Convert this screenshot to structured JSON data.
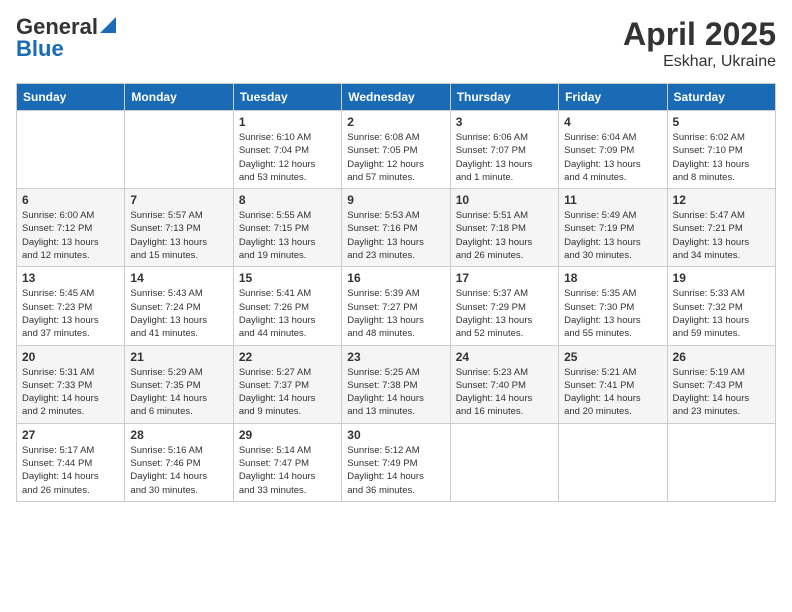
{
  "logo": {
    "general": "General",
    "blue": "Blue"
  },
  "title": {
    "month": "April 2025",
    "location": "Eskhar, Ukraine"
  },
  "weekdays": [
    "Sunday",
    "Monday",
    "Tuesday",
    "Wednesday",
    "Thursday",
    "Friday",
    "Saturday"
  ],
  "rows": [
    [
      {
        "day": "",
        "info": ""
      },
      {
        "day": "",
        "info": ""
      },
      {
        "day": "1",
        "info": "Sunrise: 6:10 AM\nSunset: 7:04 PM\nDaylight: 12 hours\nand 53 minutes."
      },
      {
        "day": "2",
        "info": "Sunrise: 6:08 AM\nSunset: 7:05 PM\nDaylight: 12 hours\nand 57 minutes."
      },
      {
        "day": "3",
        "info": "Sunrise: 6:06 AM\nSunset: 7:07 PM\nDaylight: 13 hours\nand 1 minute."
      },
      {
        "day": "4",
        "info": "Sunrise: 6:04 AM\nSunset: 7:09 PM\nDaylight: 13 hours\nand 4 minutes."
      },
      {
        "day": "5",
        "info": "Sunrise: 6:02 AM\nSunset: 7:10 PM\nDaylight: 13 hours\nand 8 minutes."
      }
    ],
    [
      {
        "day": "6",
        "info": "Sunrise: 6:00 AM\nSunset: 7:12 PM\nDaylight: 13 hours\nand 12 minutes."
      },
      {
        "day": "7",
        "info": "Sunrise: 5:57 AM\nSunset: 7:13 PM\nDaylight: 13 hours\nand 15 minutes."
      },
      {
        "day": "8",
        "info": "Sunrise: 5:55 AM\nSunset: 7:15 PM\nDaylight: 13 hours\nand 19 minutes."
      },
      {
        "day": "9",
        "info": "Sunrise: 5:53 AM\nSunset: 7:16 PM\nDaylight: 13 hours\nand 23 minutes."
      },
      {
        "day": "10",
        "info": "Sunrise: 5:51 AM\nSunset: 7:18 PM\nDaylight: 13 hours\nand 26 minutes."
      },
      {
        "day": "11",
        "info": "Sunrise: 5:49 AM\nSunset: 7:19 PM\nDaylight: 13 hours\nand 30 minutes."
      },
      {
        "day": "12",
        "info": "Sunrise: 5:47 AM\nSunset: 7:21 PM\nDaylight: 13 hours\nand 34 minutes."
      }
    ],
    [
      {
        "day": "13",
        "info": "Sunrise: 5:45 AM\nSunset: 7:23 PM\nDaylight: 13 hours\nand 37 minutes."
      },
      {
        "day": "14",
        "info": "Sunrise: 5:43 AM\nSunset: 7:24 PM\nDaylight: 13 hours\nand 41 minutes."
      },
      {
        "day": "15",
        "info": "Sunrise: 5:41 AM\nSunset: 7:26 PM\nDaylight: 13 hours\nand 44 minutes."
      },
      {
        "day": "16",
        "info": "Sunrise: 5:39 AM\nSunset: 7:27 PM\nDaylight: 13 hours\nand 48 minutes."
      },
      {
        "day": "17",
        "info": "Sunrise: 5:37 AM\nSunset: 7:29 PM\nDaylight: 13 hours\nand 52 minutes."
      },
      {
        "day": "18",
        "info": "Sunrise: 5:35 AM\nSunset: 7:30 PM\nDaylight: 13 hours\nand 55 minutes."
      },
      {
        "day": "19",
        "info": "Sunrise: 5:33 AM\nSunset: 7:32 PM\nDaylight: 13 hours\nand 59 minutes."
      }
    ],
    [
      {
        "day": "20",
        "info": "Sunrise: 5:31 AM\nSunset: 7:33 PM\nDaylight: 14 hours\nand 2 minutes."
      },
      {
        "day": "21",
        "info": "Sunrise: 5:29 AM\nSunset: 7:35 PM\nDaylight: 14 hours\nand 6 minutes."
      },
      {
        "day": "22",
        "info": "Sunrise: 5:27 AM\nSunset: 7:37 PM\nDaylight: 14 hours\nand 9 minutes."
      },
      {
        "day": "23",
        "info": "Sunrise: 5:25 AM\nSunset: 7:38 PM\nDaylight: 14 hours\nand 13 minutes."
      },
      {
        "day": "24",
        "info": "Sunrise: 5:23 AM\nSunset: 7:40 PM\nDaylight: 14 hours\nand 16 minutes."
      },
      {
        "day": "25",
        "info": "Sunrise: 5:21 AM\nSunset: 7:41 PM\nDaylight: 14 hours\nand 20 minutes."
      },
      {
        "day": "26",
        "info": "Sunrise: 5:19 AM\nSunset: 7:43 PM\nDaylight: 14 hours\nand 23 minutes."
      }
    ],
    [
      {
        "day": "27",
        "info": "Sunrise: 5:17 AM\nSunset: 7:44 PM\nDaylight: 14 hours\nand 26 minutes."
      },
      {
        "day": "28",
        "info": "Sunrise: 5:16 AM\nSunset: 7:46 PM\nDaylight: 14 hours\nand 30 minutes."
      },
      {
        "day": "29",
        "info": "Sunrise: 5:14 AM\nSunset: 7:47 PM\nDaylight: 14 hours\nand 33 minutes."
      },
      {
        "day": "30",
        "info": "Sunrise: 5:12 AM\nSunset: 7:49 PM\nDaylight: 14 hours\nand 36 minutes."
      },
      {
        "day": "",
        "info": ""
      },
      {
        "day": "",
        "info": ""
      },
      {
        "day": "",
        "info": ""
      }
    ]
  ]
}
